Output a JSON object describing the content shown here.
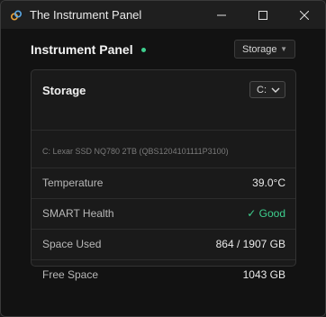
{
  "window": {
    "title": "The Instrument Panel",
    "icon": "link-icon"
  },
  "header": {
    "heading": "Instrument Panel",
    "status_color": "#3ecf8e",
    "view_select": {
      "value": "Storage",
      "caret": "▼"
    }
  },
  "card": {
    "title": "Storage",
    "drive_select": {
      "value": "C:"
    },
    "device": "C: Lexar SSD NQ780 2TB (QBS1204101111P3100)",
    "rows": [
      {
        "label": "Temperature",
        "value": "39.0°C"
      },
      {
        "label": "SMART Health",
        "value": "✓ Good",
        "status": "good"
      },
      {
        "label": "Space Used",
        "value": "864 / 1907 GB"
      },
      {
        "label": "Free Space",
        "value": "1043 GB"
      }
    ]
  },
  "colors": {
    "good": "#3ecf8e",
    "background": "#121212",
    "card": "#1a1a1a"
  }
}
